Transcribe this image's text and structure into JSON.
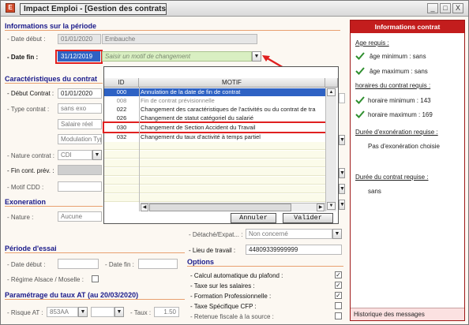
{
  "window": {
    "title": "Impact Emploi - [Gestion des contrats]",
    "icon_letter": "E",
    "buttons": {
      "minimize": "_",
      "maximize": "□",
      "close": "X"
    }
  },
  "periode": {
    "title": "Informations sur la période",
    "date_debut_label": "- Date début :",
    "date_debut_value": "01/01/2020",
    "date_debut_note": "Embauche",
    "date_fin_label": "- Date fin :",
    "date_fin_value": "31/12/2019",
    "motif_placeholder": "Saisir un motif de changement"
  },
  "caracteristiques": {
    "title": "Caractéristiques du contrat",
    "debut_contrat_label": "- Début Contrat :",
    "debut_contrat_value": "01/01/2020",
    "type_contrat_label": "- Type contrat :",
    "type_contrat_value": "sans exo",
    "salaire_value": "Salaire réel",
    "modulation_value": "Modulation Typ",
    "nature_label": "- Nature contrat :",
    "nature_value": "CDI",
    "fin_prev_label": "- Fin cont. prév. :",
    "motif_cdd_label": "- Motif CDD :"
  },
  "exoneration": {
    "title": "Exoneration",
    "nature_label": "- Nature :",
    "nature_value": "Aucune"
  },
  "essai": {
    "title": "Période d'essai",
    "date_debut_label": "- Date début :",
    "date_fin_label": "- Date fin :",
    "regime_label": "- Régime Alsace / Moselle :"
  },
  "taux_at": {
    "title": "Paramétrage du taux AT (au 20/03/2020)",
    "risque_label": "- Risque AT :",
    "risque_value": "853AA",
    "taux_label": "- Taux :",
    "taux_value": "1.50"
  },
  "middle": {
    "detache_label": "- Détaché/Expat... :",
    "detache_value": "Non concerné",
    "lieu_label": "- Lieu de travail :",
    "lieu_value": "44809339999999"
  },
  "options": {
    "title": "Options",
    "items": [
      {
        "label": "- Calcul automatique du plafond :",
        "checked": true
      },
      {
        "label": "- Taxe sur les salaires :",
        "checked": true
      },
      {
        "label": "- Formation Professionnelle :",
        "checked": true
      },
      {
        "label": "- Taxe Spécifique CFP :",
        "checked": false
      },
      {
        "label": "- Retenue fiscale à la source :",
        "checked": false
      }
    ]
  },
  "info_panel": {
    "title": "Informations contrat",
    "age_requis": "Age requis :",
    "age_min": "âge minimum : sans",
    "age_max": "âge maximum : sans",
    "horaires_requis": "horaires du contrat requis :",
    "horaire_min": "horaire minimum : 143",
    "horaire_max": "horaire maximum : 169",
    "exo_requise": "Durée d'exonération requise :",
    "exo_value": "Pas d'exonération choisie",
    "duree_requise": "Durée du contrat requise :",
    "duree_value": "sans",
    "footer": "Historique des messages"
  },
  "popup": {
    "col_id": "ID",
    "col_motif": "MOTIF",
    "rows": [
      {
        "id": "000",
        "motif": "Annulation de la date de fin de contrat"
      },
      {
        "id": "008",
        "motif": "Fin de contrat prévisionnelle"
      },
      {
        "id": "022",
        "motif": "Changement des caractéristiques de l'activités ou du contrat de tra"
      },
      {
        "id": "026",
        "motif": "Changement de statut catégoriel du salarié"
      },
      {
        "id": "030",
        "motif": "Changement de Section Accident du Travail"
      },
      {
        "id": "032",
        "motif": "Changement du taux d'activité à temps partiel"
      }
    ],
    "cancel_label": "Annuler",
    "validate_label": "Valider"
  },
  "colors": {
    "section_title": "#1a1a8a",
    "highlight_red": "#e02020",
    "selection_blue": "#2e62c4",
    "panel_header": "#c31d1d",
    "check_green": "#2f8f2f"
  },
  "icons": [
    "app-icon",
    "minimize-icon",
    "maximize-icon",
    "close-icon",
    "check-icon",
    "chevron-down-icon",
    "red-arrow-icon"
  ]
}
